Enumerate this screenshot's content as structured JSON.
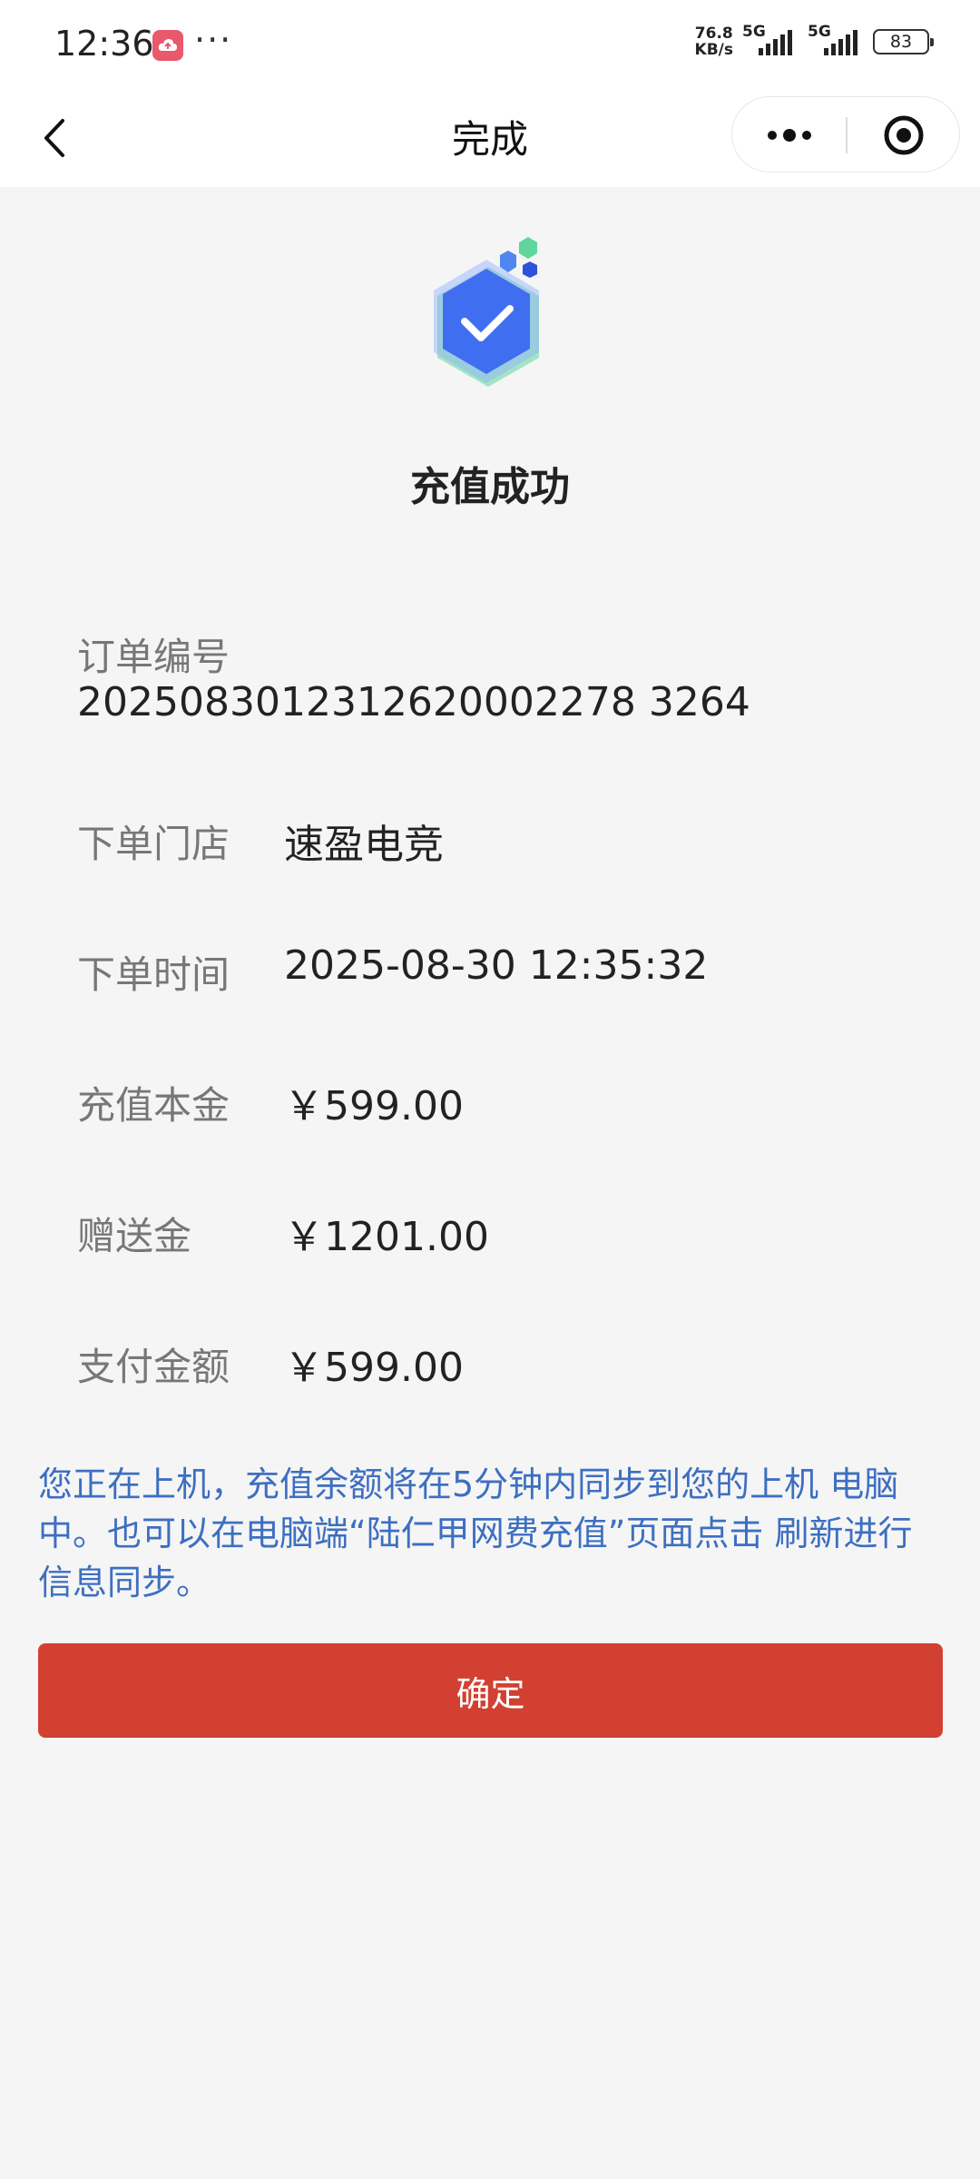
{
  "status_bar": {
    "time": "12:36",
    "dots": "···",
    "net_speed_value": "76.8",
    "net_speed_unit": "KB/s",
    "signal_1_label": "5G",
    "signal_2_label": "5G",
    "battery": "83"
  },
  "nav": {
    "title": "完成"
  },
  "result": {
    "title": "充值成功"
  },
  "details": {
    "order_no_label": "订单编号",
    "order_no_value": "2025083012312620002278 3264",
    "store_label": "下单门店",
    "store_value": "速盈电竞",
    "time_label": "下单时间",
    "time_value": "2025-08-30 12:35:32",
    "principal_label": "充值本金",
    "principal_value": "￥599.00",
    "bonus_label": "赠送金",
    "bonus_value": "￥1201.00",
    "paid_label": "支付金额",
    "paid_value": "￥599.00"
  },
  "notice": {
    "text": "您正在上机，充值余额将在5分钟内同步到您的上机 电脑中。也可以在电脑端“陆仁甲网费充值”页面点击 刷新进行信息同步。"
  },
  "actions": {
    "confirm_label": "确定"
  },
  "colors": {
    "accent_red": "#d24031",
    "notice_blue": "#3d6fc1",
    "icon_blue": "#3f6ff0",
    "icon_green": "#5fd69b"
  }
}
